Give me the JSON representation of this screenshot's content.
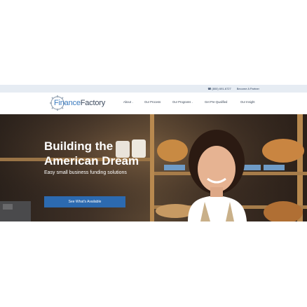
{
  "topbar": {
    "phone": "(800) 691-6727",
    "partner_link": "Become A Partner"
  },
  "brand": {
    "name_part1": "Finance",
    "name_part2": "Factory"
  },
  "nav": {
    "items": [
      {
        "label": "About",
        "has_dropdown": true
      },
      {
        "label": "Our Process",
        "has_dropdown": false
      },
      {
        "label": "Our Programs",
        "has_dropdown": true
      },
      {
        "label": "Get Pre-Qualified",
        "has_dropdown": false
      },
      {
        "label": "Our Insight",
        "has_dropdown": false
      }
    ],
    "caret": "⌄"
  },
  "hero": {
    "title_line1": "Building the",
    "title_line2": "American Dream",
    "subtitle": "Easy small business funding solutions",
    "cta_label": "See What's Available"
  },
  "colors": {
    "brand_blue": "#3b7bbf",
    "button_blue": "#2c6ab0",
    "topbar_bg": "#e6ecf3"
  }
}
